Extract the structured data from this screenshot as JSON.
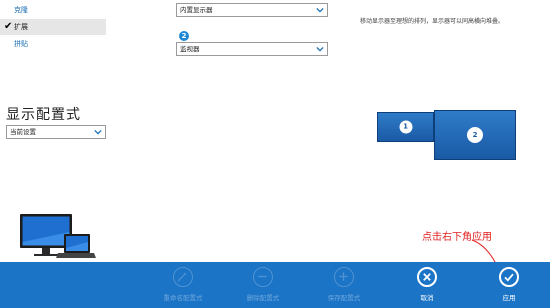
{
  "arrangement_menu": {
    "items": [
      {
        "label": "克隆",
        "selected": false
      },
      {
        "label": "扩展",
        "selected": true
      },
      {
        "label": "拼贴",
        "selected": false
      }
    ]
  },
  "display_config": {
    "heading": "显示配置式",
    "profile_select": "当前设置"
  },
  "monitor_selects": {
    "first": "内置显示器",
    "second_badge": "2",
    "second": "监视器"
  },
  "layout_hint": "移动显示器至理想的排列，显示器可以同高横向堆叠。",
  "layout": {
    "monitor_1": "1",
    "monitor_2": "2"
  },
  "annotation": "点击右下角应用",
  "actions": [
    {
      "label": "重命名配置式",
      "icon": "pencil-icon",
      "enabled": false
    },
    {
      "label": "删除配置式",
      "icon": "minus-icon",
      "enabled": false
    },
    {
      "label": "保存配置式",
      "icon": "plus-icon",
      "enabled": false
    },
    {
      "label": "取消",
      "icon": "close-icon",
      "enabled": true
    },
    {
      "label": "应用",
      "icon": "checkmark-icon",
      "enabled": true
    }
  ],
  "colors": {
    "bar": "#1b74c6",
    "monitor": "#1a5aa5",
    "annotation": "#e02020"
  }
}
